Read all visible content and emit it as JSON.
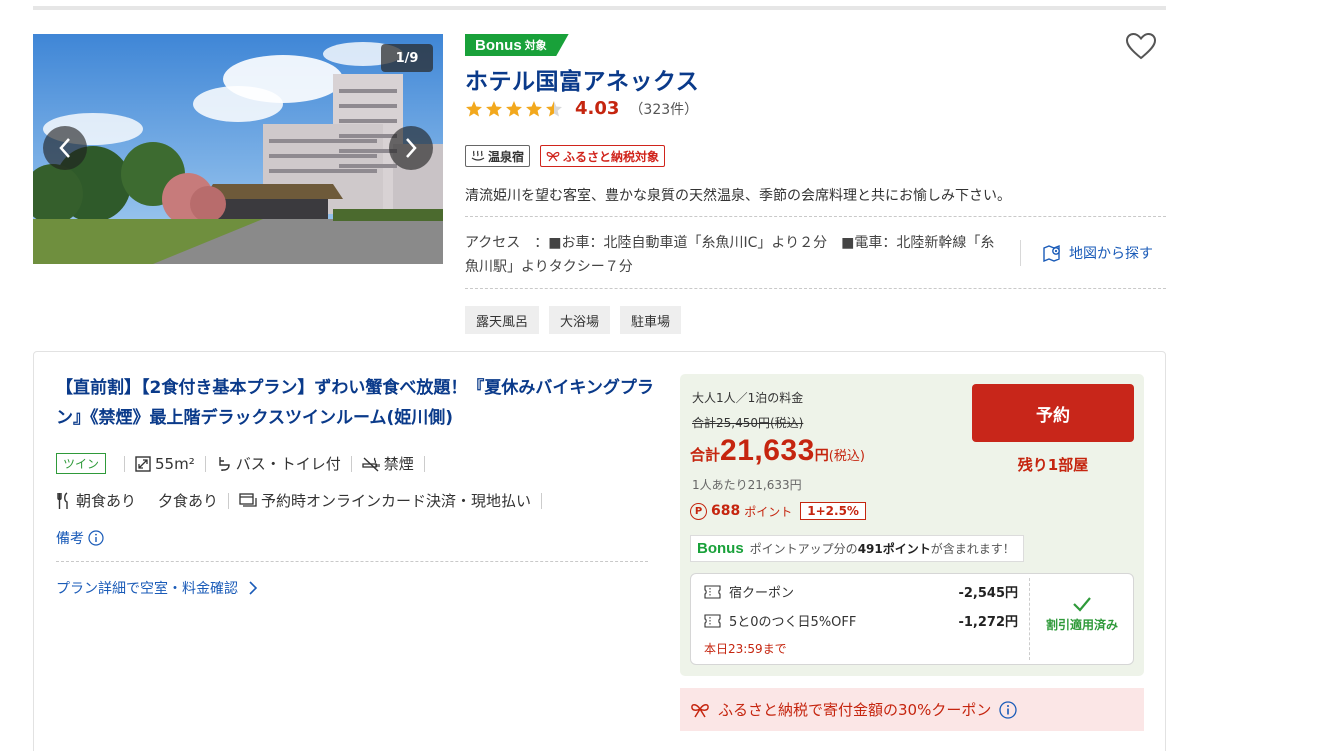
{
  "hotel": {
    "gallery_counter": "1/9",
    "bonus_label": "Bonus",
    "bonus_suffix": "対象",
    "name": "ホテル国富アネックス",
    "rating_value": 4.03,
    "rating": "4.03",
    "review_count": "（323件）",
    "badges": {
      "onsen": "温泉宿",
      "furusato": "ふるさと納税対象"
    },
    "description": "清流姫川を望む客室、豊かな泉質の天然温泉、季節の会席料理と共にお愉しみ下さい。",
    "access": "アクセス　：■お車：北陸自動車道「糸魚川IC」より２分　■電車：北陸新幹線「糸魚川駅」よりタクシー７分",
    "map_link": "地図から探す",
    "amenities": [
      "露天風呂",
      "大浴場",
      "駐車場"
    ]
  },
  "plan": {
    "title": "【直前割】【2食付き基本プラン】ずわい蟹食べ放題！『夏休みバイキングプラン』《禁煙》最上階デラックスツインルーム(姫川側)",
    "room_type": "ツイン",
    "room_size": "55m²",
    "bath": "バス・トイレ付",
    "smoking": "禁煙",
    "breakfast": "朝食あり",
    "dinner": "夕食あり",
    "payment": "予約時オンラインカード決済・現地払い",
    "remarks": "備考",
    "detail_link": "プラン詳細で空室・料金確認"
  },
  "price": {
    "per_person_label": "大人1人／1泊の料金",
    "original": "合計25,450円(税込)",
    "total_label": "合計",
    "total_amount": "21,633",
    "yen": "円",
    "tax_label": "(税込)",
    "per_person_price": "1人あたり21,633円",
    "points_icon": "P",
    "points": "688",
    "points_unit": "ポイント",
    "points_rate": "1+2.5%",
    "bonus_label": "Bonus",
    "bonus_note_pre": "ポイントアップ分の",
    "bonus_note_pts": "491ポイント",
    "bonus_note_post": "が含まれます！",
    "reserve_button": "予約",
    "rooms_left": "残り1部屋"
  },
  "coupons": {
    "items": [
      {
        "name": "宿クーポン",
        "amount": "-2,545円"
      },
      {
        "name": "5と0のつく日5%OFF",
        "amount": "-1,272円"
      }
    ],
    "deadline": "本日23:59まで",
    "applied_label": "割引適用済み"
  },
  "furusato_banner": "ふるさと納税で寄付金額の30%クーポン",
  "colors": {
    "brand_blue": "#0a3a8a",
    "accent_red": "#c5250f",
    "bonus_green": "#19a13a",
    "price_panel_bg": "#eef3e9"
  }
}
